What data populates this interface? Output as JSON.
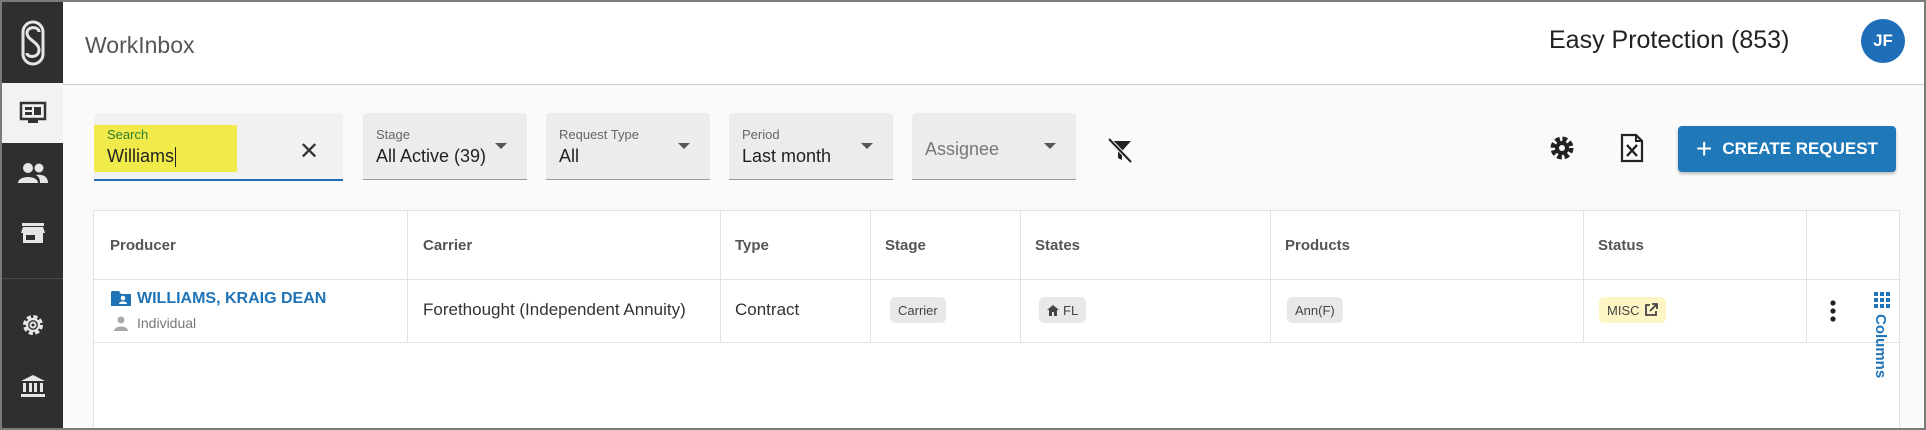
{
  "app": {
    "page_title": "WorkInbox",
    "company": "Easy Protection (853)",
    "user_initials": "JF"
  },
  "sidebar": {
    "items": [
      {
        "name": "dashboard",
        "icon": "dashboard-icon",
        "active": true
      },
      {
        "name": "contacts",
        "icon": "people-icon"
      },
      {
        "name": "store",
        "icon": "store-icon"
      },
      {
        "name": "settings",
        "icon": "gear-icon"
      },
      {
        "name": "institution",
        "icon": "bank-icon"
      }
    ]
  },
  "filters": {
    "search": {
      "label": "Search",
      "value": "Williams"
    },
    "stage": {
      "label": "Stage",
      "value": "All Active (39)"
    },
    "request_type": {
      "label": "Request Type",
      "value": "All"
    },
    "period": {
      "label": "Period",
      "value": "Last month"
    },
    "assignee": {
      "placeholder": "Assignee"
    }
  },
  "toolbar": {
    "create_label": "CREATE REQUEST"
  },
  "table": {
    "columns": [
      "Producer",
      "Carrier",
      "Type",
      "Stage",
      "States",
      "Products",
      "Status"
    ],
    "rows": [
      {
        "producer": "WILLIAMS, KRAIG DEAN",
        "producer_type": "Individual",
        "carrier": "Forethought (Independent Annuity)",
        "type": "Contract",
        "stage": "Carrier",
        "state": "FL",
        "product": "Ann(F)",
        "status": "MISC"
      }
    ],
    "columns_tab_label": "Columns"
  },
  "colors": {
    "accent": "#1f78b8",
    "sidebar": "#2f2f2f",
    "search_highlight": "#f0ea4a",
    "status_chip": "#fdf5c4"
  }
}
